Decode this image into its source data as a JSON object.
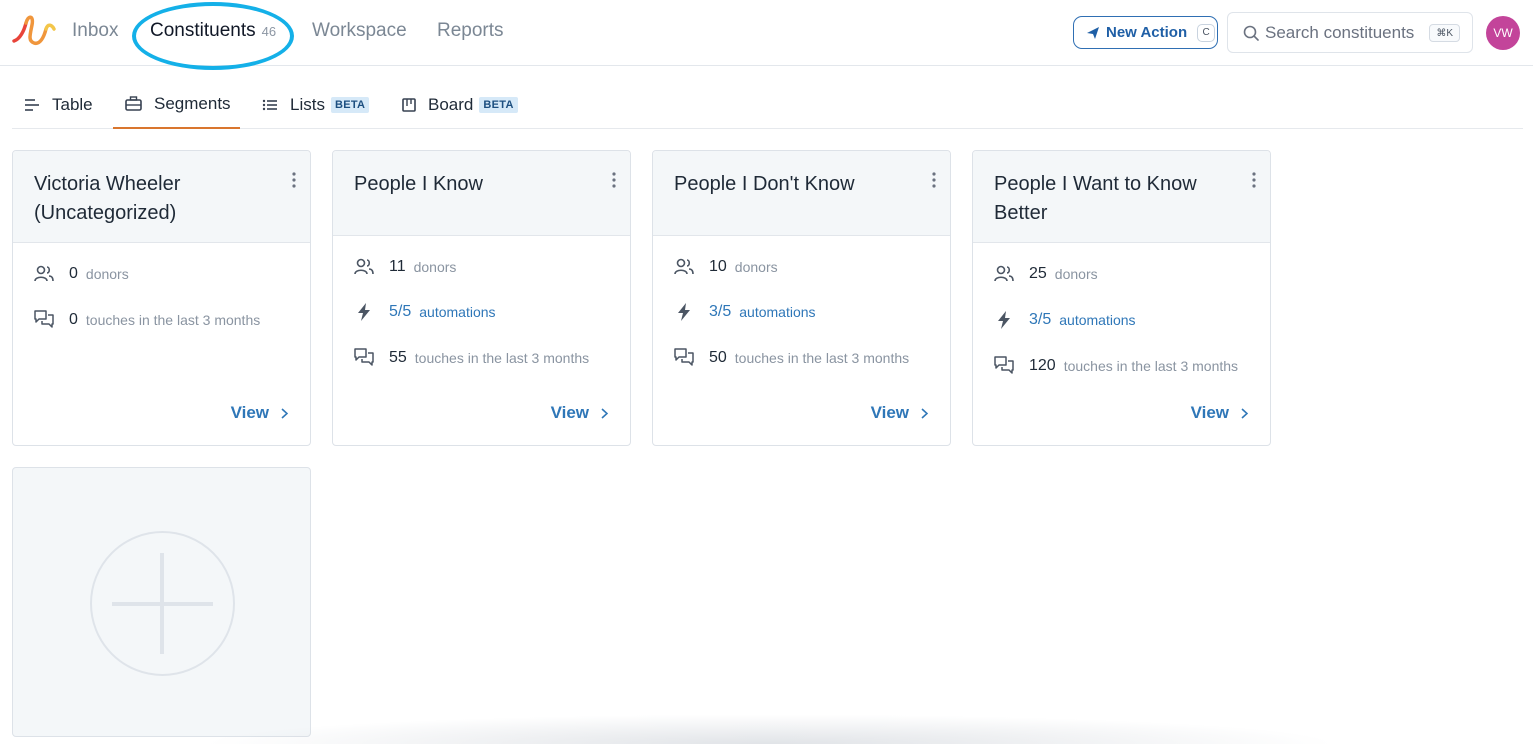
{
  "nav": {
    "items": [
      {
        "label": "Inbox"
      },
      {
        "label": "Constituents",
        "count": "46"
      },
      {
        "label": "Workspace"
      },
      {
        "label": "Reports"
      }
    ],
    "new_action": {
      "label": "New Action",
      "shortcut": "C"
    },
    "search": {
      "placeholder": "Search constituents",
      "shortcut": "⌘K"
    },
    "avatar_initials": "VW"
  },
  "subtabs": [
    {
      "label": "Table",
      "icon": "table-icon"
    },
    {
      "label": "Segments",
      "icon": "segments-icon",
      "active": true
    },
    {
      "label": "Lists",
      "icon": "list-icon",
      "badge": "BETA"
    },
    {
      "label": "Board",
      "icon": "board-icon",
      "badge": "BETA"
    }
  ],
  "cards": [
    {
      "title": "Victoria Wheeler (Uncategorized)",
      "donors": {
        "value": "0",
        "label": "donors"
      },
      "touches": {
        "value": "0",
        "label": "touches in the last 3 months"
      },
      "view": "View"
    },
    {
      "title": "People I Know",
      "donors": {
        "value": "11",
        "label": "donors"
      },
      "automations": {
        "value": "5/5",
        "label": "automations"
      },
      "touches": {
        "value": "55",
        "label": "touches in the last 3 months"
      },
      "view": "View"
    },
    {
      "title": "People I Don't Know",
      "donors": {
        "value": "10",
        "label": "donors"
      },
      "automations": {
        "value": "3/5",
        "label": "automations"
      },
      "touches": {
        "value": "50",
        "label": "touches in the last 3 months"
      },
      "view": "View"
    },
    {
      "title": "People I Want to Know Better",
      "donors": {
        "value": "25",
        "label": "donors"
      },
      "automations": {
        "value": "3/5",
        "label": "automations"
      },
      "touches": {
        "value": "120",
        "label": "touches in the last 3 months"
      },
      "view": "View"
    }
  ],
  "colors": {
    "accent_blue": "#2f77b8",
    "highlight_ring": "#14b0e8",
    "active_tab_underline": "#d9762e",
    "avatar": "#c3449a"
  }
}
